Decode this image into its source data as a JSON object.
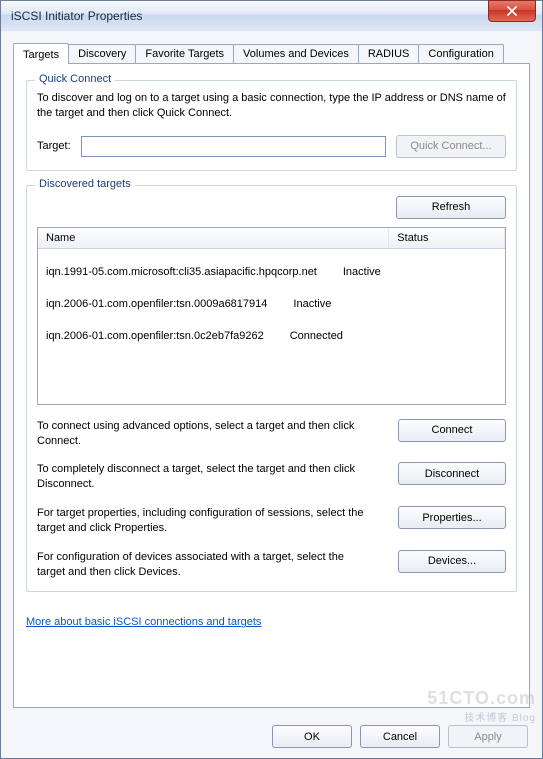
{
  "window": {
    "title": "iSCSI Initiator Properties"
  },
  "tabs": {
    "items": [
      {
        "label": "Targets"
      },
      {
        "label": "Discovery"
      },
      {
        "label": "Favorite Targets"
      },
      {
        "label": "Volumes and Devices"
      },
      {
        "label": "RADIUS"
      },
      {
        "label": "Configuration"
      }
    ],
    "active_index": 0
  },
  "quick_connect": {
    "legend": "Quick Connect",
    "help": "To discover and log on to a target using a basic connection, type the IP address or DNS name of the target and then click Quick Connect.",
    "target_label": "Target:",
    "target_value": "",
    "button": "Quick Connect..."
  },
  "discovered": {
    "legend": "Discovered targets",
    "refresh": "Refresh",
    "columns": {
      "name": "Name",
      "status": "Status"
    },
    "rows": [
      {
        "name": "iqn.1991-05.com.microsoft:cli35.asiapacific.hpqcorp.net",
        "status": "Inactive"
      },
      {
        "name": "iqn.2006-01.com.openfiler:tsn.0009a6817914",
        "status": "Inactive"
      },
      {
        "name": "iqn.2006-01.com.openfiler:tsn.0c2eb7fa9262",
        "status": "Connected"
      }
    ],
    "actions": {
      "connect": {
        "text": "To connect using advanced options, select a target and then click Connect.",
        "button": "Connect"
      },
      "disconnect": {
        "text": "To completely disconnect a target, select the target and then click Disconnect.",
        "button": "Disconnect"
      },
      "properties": {
        "text": "For target properties, including configuration of sessions, select the target and click Properties.",
        "button": "Properties..."
      },
      "devices": {
        "text": "For configuration of devices associated with a target, select the target and then click Devices.",
        "button": "Devices..."
      }
    }
  },
  "link": {
    "label": "More about basic iSCSI connections and targets"
  },
  "footer": {
    "ok": "OK",
    "cancel": "Cancel",
    "apply": "Apply"
  },
  "watermark": {
    "big": "51CTO.com",
    "small": "技术博客  Blog"
  }
}
